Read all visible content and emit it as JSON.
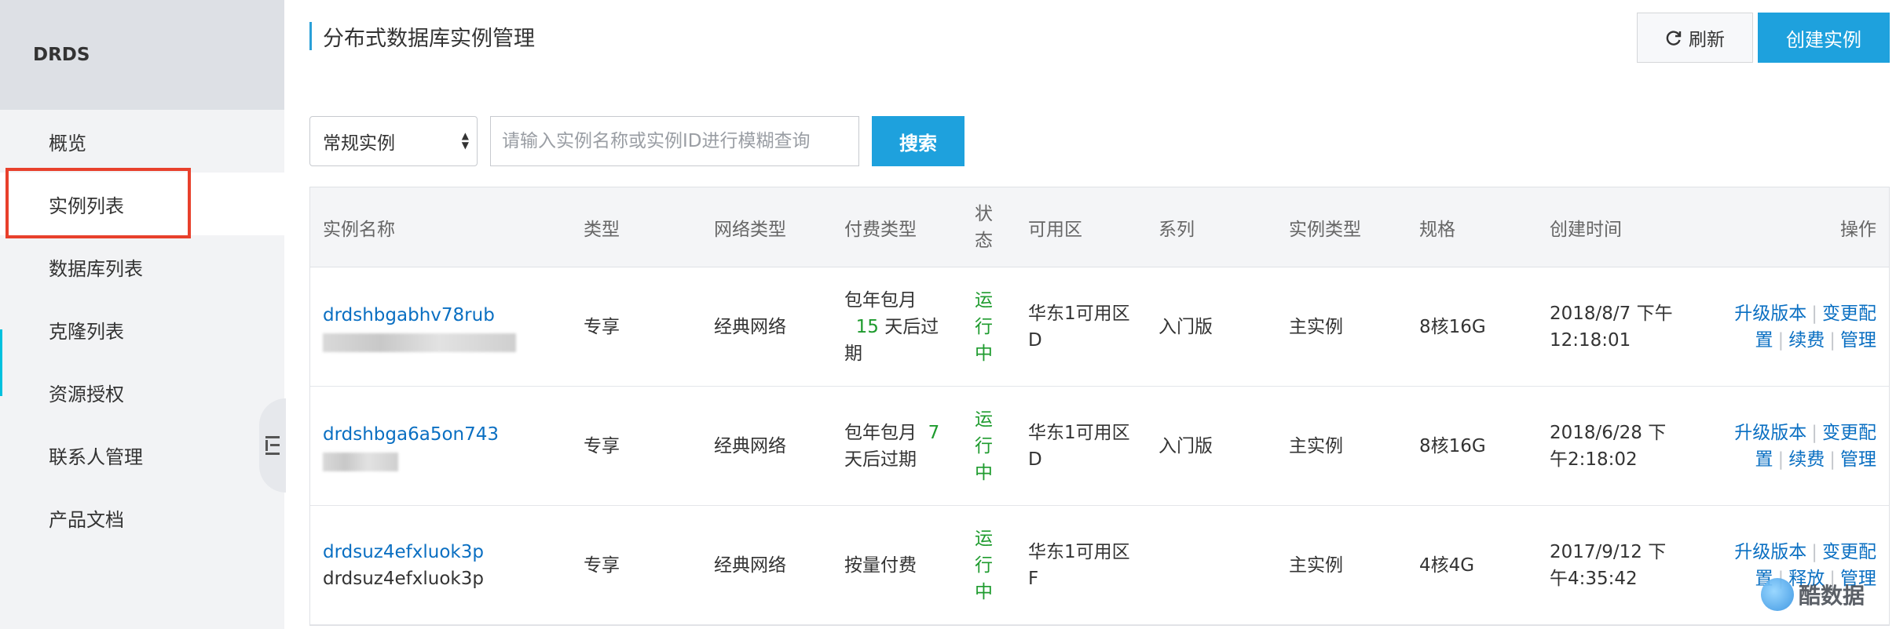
{
  "sidebar": {
    "brand": "DRDS",
    "items": [
      {
        "label": "概览"
      },
      {
        "label": "实例列表"
      },
      {
        "label": "数据库列表"
      },
      {
        "label": "克隆列表"
      },
      {
        "label": "资源授权"
      },
      {
        "label": "联系人管理"
      },
      {
        "label": "产品文档"
      }
    ],
    "active_index": 1
  },
  "header": {
    "title": "分布式数据库实例管理",
    "refresh_label": "刷新",
    "create_label": "创建实例"
  },
  "filter": {
    "select_value": "常规实例",
    "search_placeholder": "请输入实例名称或实例ID进行模糊查询",
    "search_button": "搜索"
  },
  "table": {
    "columns": [
      "实例名称",
      "类型",
      "网络类型",
      "付费类型",
      "状态",
      "可用区",
      "系列",
      "实例类型",
      "规格",
      "创建时间",
      "操作"
    ],
    "status_header_lines": [
      "状",
      "态"
    ],
    "rows": [
      {
        "name": "drdshbgabhv78rub",
        "pay_line1": "包年包月",
        "pay_days": "15",
        "pay_line2": "天后过",
        "pay_line3": "期",
        "type": "专享",
        "network": "经典网络",
        "status": [
          "运",
          "行",
          "中"
        ],
        "zone_line1": "华东1可用区",
        "zone_line2": "D",
        "series": "入门版",
        "instance_type": "主实例",
        "spec": "8核16G",
        "created_line1": "2018/8/7 下午",
        "created_line2": "12:18:01",
        "ops": [
          "升级版本",
          "变更配",
          "置",
          "续费",
          "管理"
        ]
      },
      {
        "name": "drdshbga6a5on743",
        "pay_line1": "包年包月",
        "pay_days": "7",
        "pay_line2": "天后过期",
        "type": "专享",
        "network": "经典网络",
        "status": [
          "运",
          "行",
          "中"
        ],
        "zone_line1": "华东1可用区",
        "zone_line2": "D",
        "series": "入门版",
        "instance_type": "主实例",
        "spec": "8核16G",
        "created_line1": "2018/6/28 下",
        "created_line2": "午2:18:02",
        "ops": [
          "升级版本",
          "变更配",
          "置",
          "续费",
          "管理"
        ]
      },
      {
        "name": "drdsuz4efxluok3p",
        "subname": "drdsuz4efxluok3p",
        "pay": "按量付费",
        "type": "专享",
        "network": "经典网络",
        "status": [
          "运",
          "行",
          "中"
        ],
        "zone_line1": "华东1可用区",
        "zone_line2": "F",
        "series": "",
        "instance_type": "主实例",
        "spec": "4核4G",
        "created_line1": "2017/9/12 下",
        "created_line2": "午4:35:42",
        "ops": [
          "升级版本",
          "变更配",
          "置",
          "释放",
          "管理"
        ]
      }
    ]
  },
  "watermark": "酷数据",
  "colors": {
    "accent": "#1ea1dd",
    "link": "#0a6fc2",
    "status_running": "#1e9b2e",
    "highlight_box": "#e8402c"
  }
}
